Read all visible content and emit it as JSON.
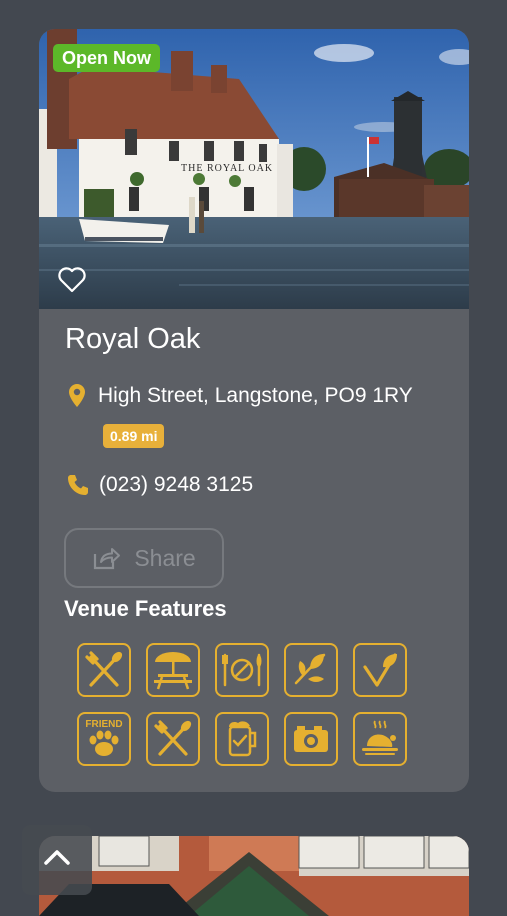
{
  "venue": {
    "status_badge": "Open Now",
    "name": "Royal Oak",
    "address": "High Street, Langstone, PO9 1RY",
    "distance": "0.89 mi",
    "phone": "(023) 9248 3125",
    "photo_sign_text": "THE ROYAL OAK"
  },
  "actions": {
    "share_label": "Share"
  },
  "features": {
    "title": "Venue Features",
    "items": [
      {
        "icon": "cutlery-icon"
      },
      {
        "icon": "beer-garden-icon"
      },
      {
        "icon": "no-food-icon"
      },
      {
        "icon": "vegetarian-icon"
      },
      {
        "icon": "vegan-icon"
      },
      {
        "icon": "dog-friendly-icon",
        "label": "FRIEND"
      },
      {
        "icon": "cutlery-icon"
      },
      {
        "icon": "beer-menu-icon"
      },
      {
        "icon": "camera-icon"
      },
      {
        "icon": "roast-dinner-icon"
      }
    ]
  },
  "colors": {
    "accent": "#e5b030",
    "open_badge": "#5cb829",
    "card": "#5c5f65",
    "page": "#434850"
  }
}
